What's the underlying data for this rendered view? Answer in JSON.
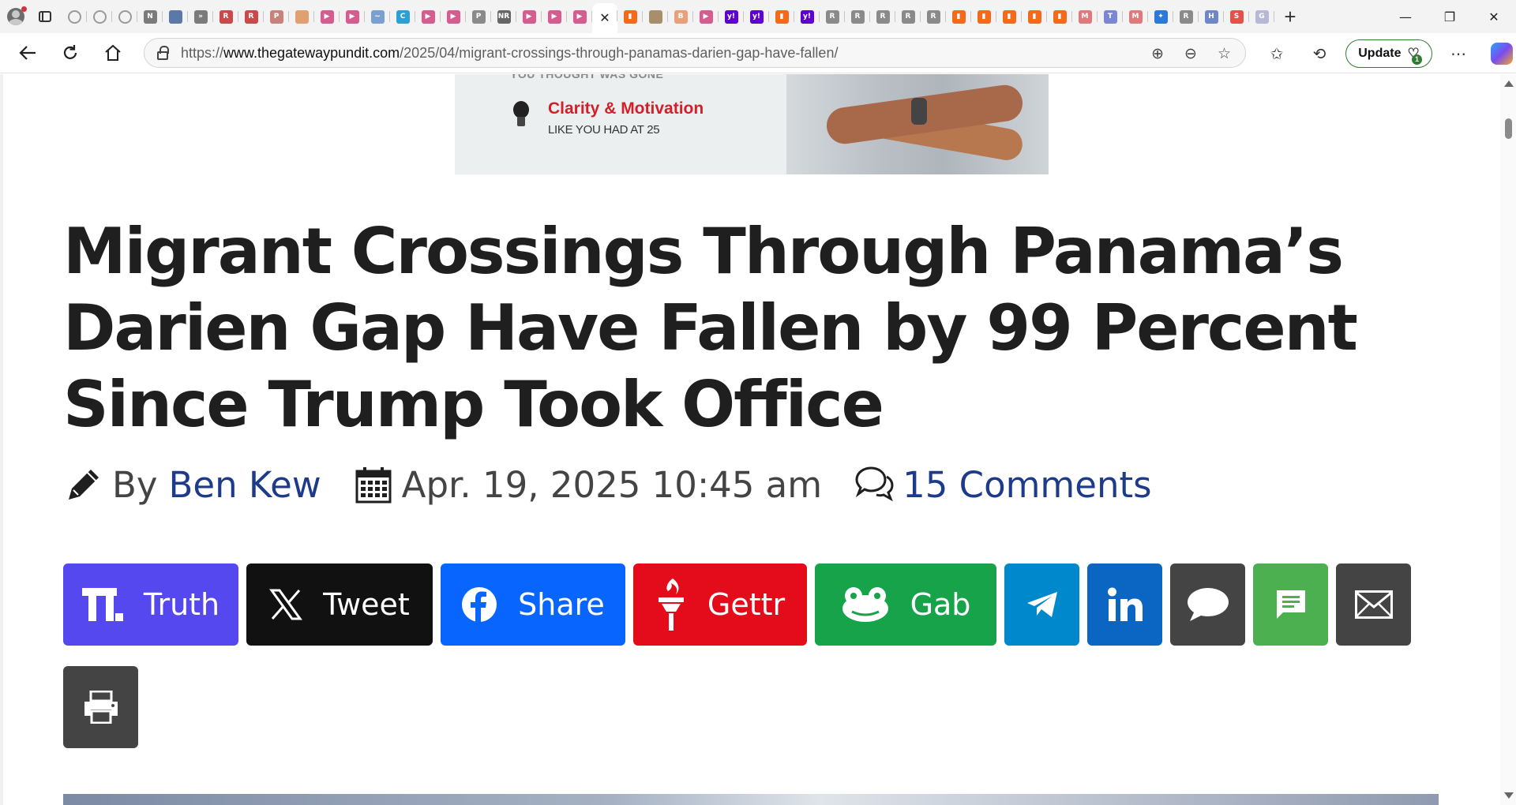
{
  "browser": {
    "active_tab_close": "✕",
    "new_tab": "+",
    "url_prefix": "https://",
    "url_domain": "www.thegatewaypundit.com",
    "url_path": "/2025/04/migrant-crossings-through-panamas-darien-gap-have-fallen/",
    "update_label": "Update",
    "update_badge": "1"
  },
  "tabs": [
    {
      "icon": "globe-icon",
      "text": "",
      "color": "#9a9a9a"
    },
    {
      "icon": "globe-icon",
      "text": "",
      "color": "#9a9a9a"
    },
    {
      "icon": "globe-icon",
      "text": "",
      "color": "#9a9a9a"
    },
    {
      "icon": "news-icon",
      "text": "N",
      "color": "#7b7b7b"
    },
    {
      "icon": "doc-icon",
      "text": "",
      "color": "#5a79a8"
    },
    {
      "icon": "arrows-icon",
      "text": "»",
      "color": "#7b7b7b"
    },
    {
      "icon": "r-icon",
      "text": "R",
      "color": "#c94a4a"
    },
    {
      "icon": "r-icon",
      "text": "R",
      "color": "#c94a4a"
    },
    {
      "icon": "pdf-icon",
      "text": "P",
      "color": "#c9827b"
    },
    {
      "icon": "circle-icon",
      "text": "",
      "color": "#e0a070"
    },
    {
      "icon": "video-icon",
      "text": "▶",
      "color": "#d65b8f"
    },
    {
      "icon": "video-icon",
      "text": "▶",
      "color": "#d65b8f"
    },
    {
      "icon": "feather-icon",
      "text": "~",
      "color": "#7aa0d0"
    },
    {
      "icon": "c-icon",
      "text": "C",
      "color": "#2b9fd6"
    },
    {
      "icon": "video-icon",
      "text": "▶",
      "color": "#d65b8f"
    },
    {
      "icon": "video-icon",
      "text": "▶",
      "color": "#d65b8f"
    },
    {
      "icon": "pdf-icon",
      "text": "P",
      "color": "#8a8a8a"
    },
    {
      "icon": "nr-icon",
      "text": "NR",
      "color": "#666666"
    },
    {
      "icon": "video-icon",
      "text": "▶",
      "color": "#d65b8f"
    },
    {
      "icon": "video-icon",
      "text": "▶",
      "color": "#d65b8f"
    },
    {
      "icon": "video-icon",
      "text": "▶",
      "color": "#d65b8f"
    },
    {
      "icon": "close-icon",
      "text": "✕",
      "color": "#222222",
      "active": true
    },
    {
      "icon": "bookmark-icon",
      "text": "▮",
      "color": "#f26b1d"
    },
    {
      "icon": "image-icon",
      "text": "",
      "color": "#a88e6a"
    },
    {
      "icon": "b-icon",
      "text": "B",
      "color": "#e9a07a"
    },
    {
      "icon": "video-icon",
      "text": "▶",
      "color": "#d65b8f"
    },
    {
      "icon": "yahoo-icon",
      "text": "y!",
      "color": "#5f01d1"
    },
    {
      "icon": "yahoo-icon",
      "text": "y!",
      "color": "#5f01d1"
    },
    {
      "icon": "bookmark-icon",
      "text": "▮",
      "color": "#f26b1d"
    },
    {
      "icon": "yahoo-icon",
      "text": "y!",
      "color": "#5f01d1"
    },
    {
      "icon": "r-icon",
      "text": "R",
      "color": "#8a8a8a"
    },
    {
      "icon": "r-icon",
      "text": "R",
      "color": "#8a8a8a"
    },
    {
      "icon": "r-icon",
      "text": "R",
      "color": "#8a8a8a"
    },
    {
      "icon": "r-icon",
      "text": "R",
      "color": "#8a8a8a"
    },
    {
      "icon": "r-icon",
      "text": "R",
      "color": "#8a8a8a"
    },
    {
      "icon": "bookmark-icon",
      "text": "▮",
      "color": "#f26b1d"
    },
    {
      "icon": "bookmark-icon",
      "text": "▮",
      "color": "#f26b1d"
    },
    {
      "icon": "bookmark-icon",
      "text": "▮",
      "color": "#f26b1d"
    },
    {
      "icon": "bookmark-icon",
      "text": "▮",
      "color": "#f26b1d"
    },
    {
      "icon": "bookmark-icon",
      "text": "▮",
      "color": "#f26b1d"
    },
    {
      "icon": "m-icon",
      "text": "M",
      "color": "#e07a7a"
    },
    {
      "icon": "t-icon",
      "text": "T",
      "color": "#7b86d6"
    },
    {
      "icon": "m-icon",
      "text": "M",
      "color": "#e07a7a"
    },
    {
      "icon": "puzzle-icon",
      "text": "✦",
      "color": "#2b7bd6"
    },
    {
      "icon": "r-icon",
      "text": "R",
      "color": "#8a8a8a"
    },
    {
      "icon": "h-icon",
      "text": "H",
      "color": "#6f86c9"
    },
    {
      "icon": "s-icon",
      "text": "S",
      "color": "#e0524a"
    },
    {
      "icon": "g-icon",
      "text": "G",
      "color": "#b7b7d8"
    }
  ],
  "ad": {
    "cut_text": "YOU THOUGHT WAS GONE",
    "headline": "Clarity & Motivation",
    "subline": "LIKE YOU HAD AT 25"
  },
  "article": {
    "title": "Migrant Crossings Through Panama’s Darien Gap Have Fallen by 99 Percent Since Trump Took Office",
    "by_label": "By",
    "author": "Ben Kew",
    "date": "Apr. 19, 2025 10:45 am",
    "comments": "15 Comments"
  },
  "share": {
    "truth": {
      "label": "Truth",
      "color": "#5448ee"
    },
    "tweet": {
      "label": "Tweet",
      "color": "#111111"
    },
    "facebook": {
      "label": "Share",
      "color": "#0866ff"
    },
    "gettr": {
      "label": "Gettr",
      "color": "#e40c1a"
    },
    "gab": {
      "label": "Gab",
      "color": "#16a34a"
    },
    "telegram": {
      "color": "#0088cc"
    },
    "linkedin": {
      "color": "#0a66c2"
    },
    "message": {
      "color": "#444444"
    },
    "sms": {
      "color": "#4caf50"
    },
    "email": {
      "color": "#444444"
    },
    "print": {
      "color": "#444444"
    }
  }
}
